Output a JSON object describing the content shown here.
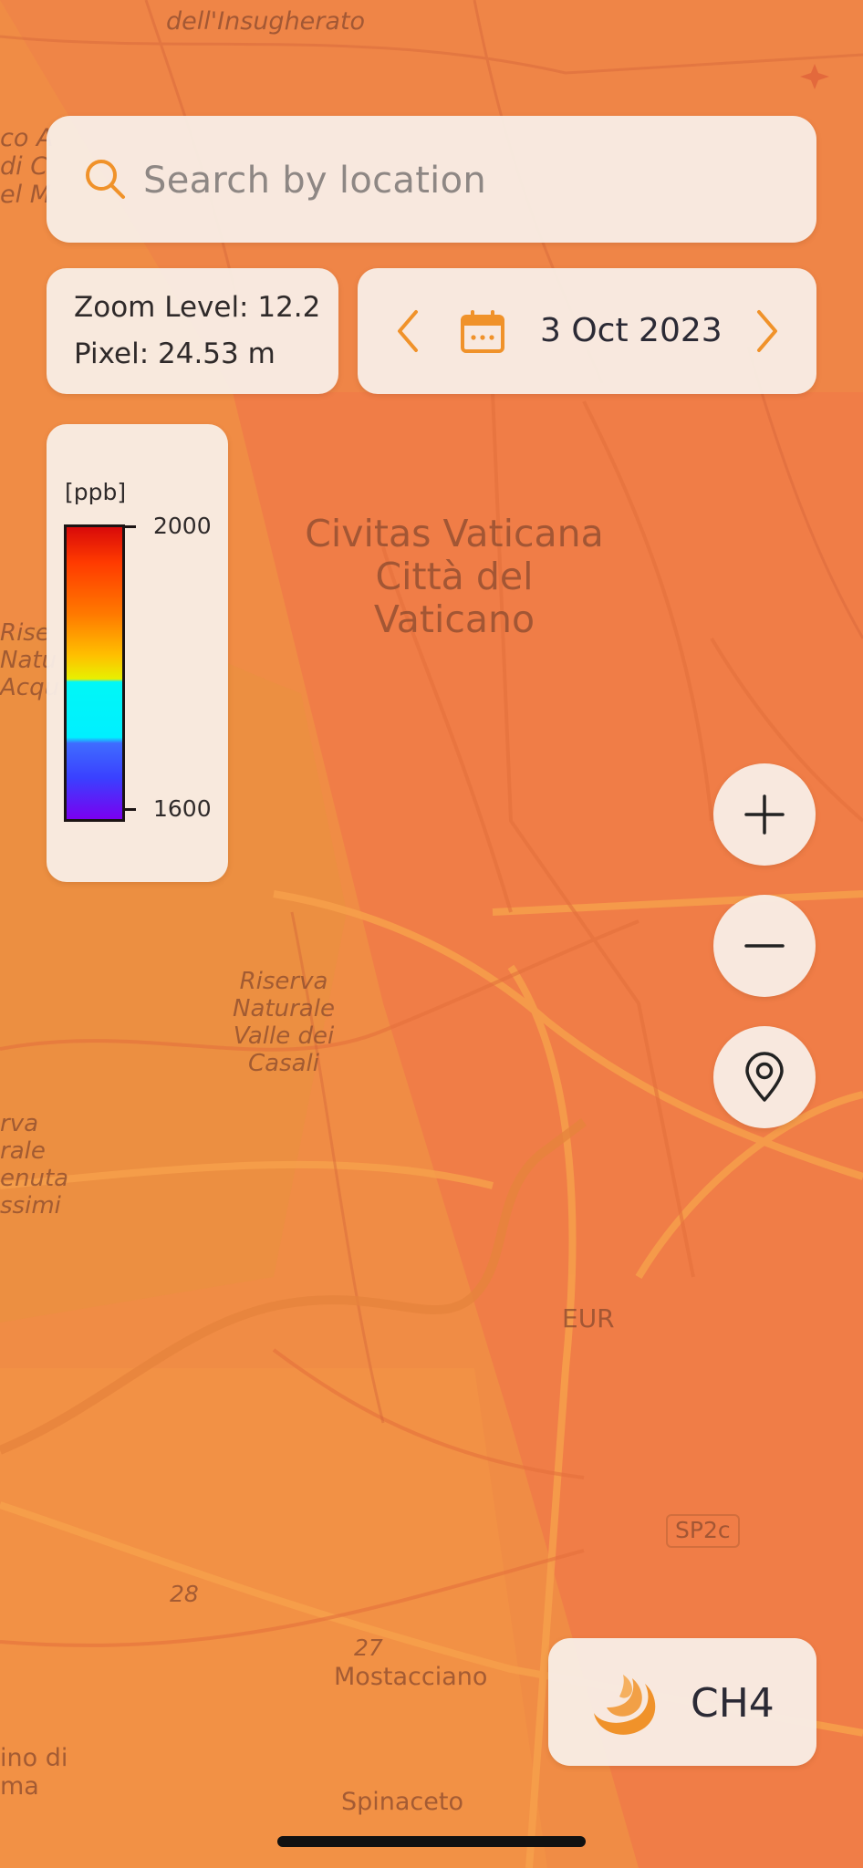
{
  "search": {
    "placeholder": "Search by location"
  },
  "info": {
    "zoom_level": "Zoom Level: 12.2",
    "pixel": "Pixel: 24.53 m"
  },
  "date": {
    "label": "3 Oct 2023"
  },
  "legend": {
    "unit": "[ppb]",
    "max_label": "2000",
    "min_label": "1600",
    "max": 2000,
    "min": 1600
  },
  "gas": {
    "label": "CH4"
  },
  "map_labels": {
    "insugherato": "dell'Insugherato",
    "vatican": "Civitas Vaticana\nCittà del\nVaticano",
    "riserva": "Riserva\nNaturale\nValle dei\nCasali",
    "eur": "EUR",
    "sp2c": "SP2c",
    "mostacciano": "Mostacciano",
    "spinaceto": "Spinaceto",
    "r28": "28",
    "r27": "27",
    "rise_left": "Rise\nNatu\nAcqu",
    "erva_left": "rva\nrale\nenuta\nssimi",
    "ino_di": "ino di\nma",
    "co_a": "co A\ndi C\nel M"
  },
  "colors": {
    "accent": "#f0922a",
    "map_tint": "#f08d46",
    "panel": "#f8ece4",
    "text": "#2b2a35"
  },
  "icons": [
    "search-icon",
    "chevron-left-icon",
    "calendar-icon",
    "chevron-right-icon",
    "plus-icon",
    "minus-icon",
    "location-pin-icon",
    "gas-logo-icon"
  ]
}
